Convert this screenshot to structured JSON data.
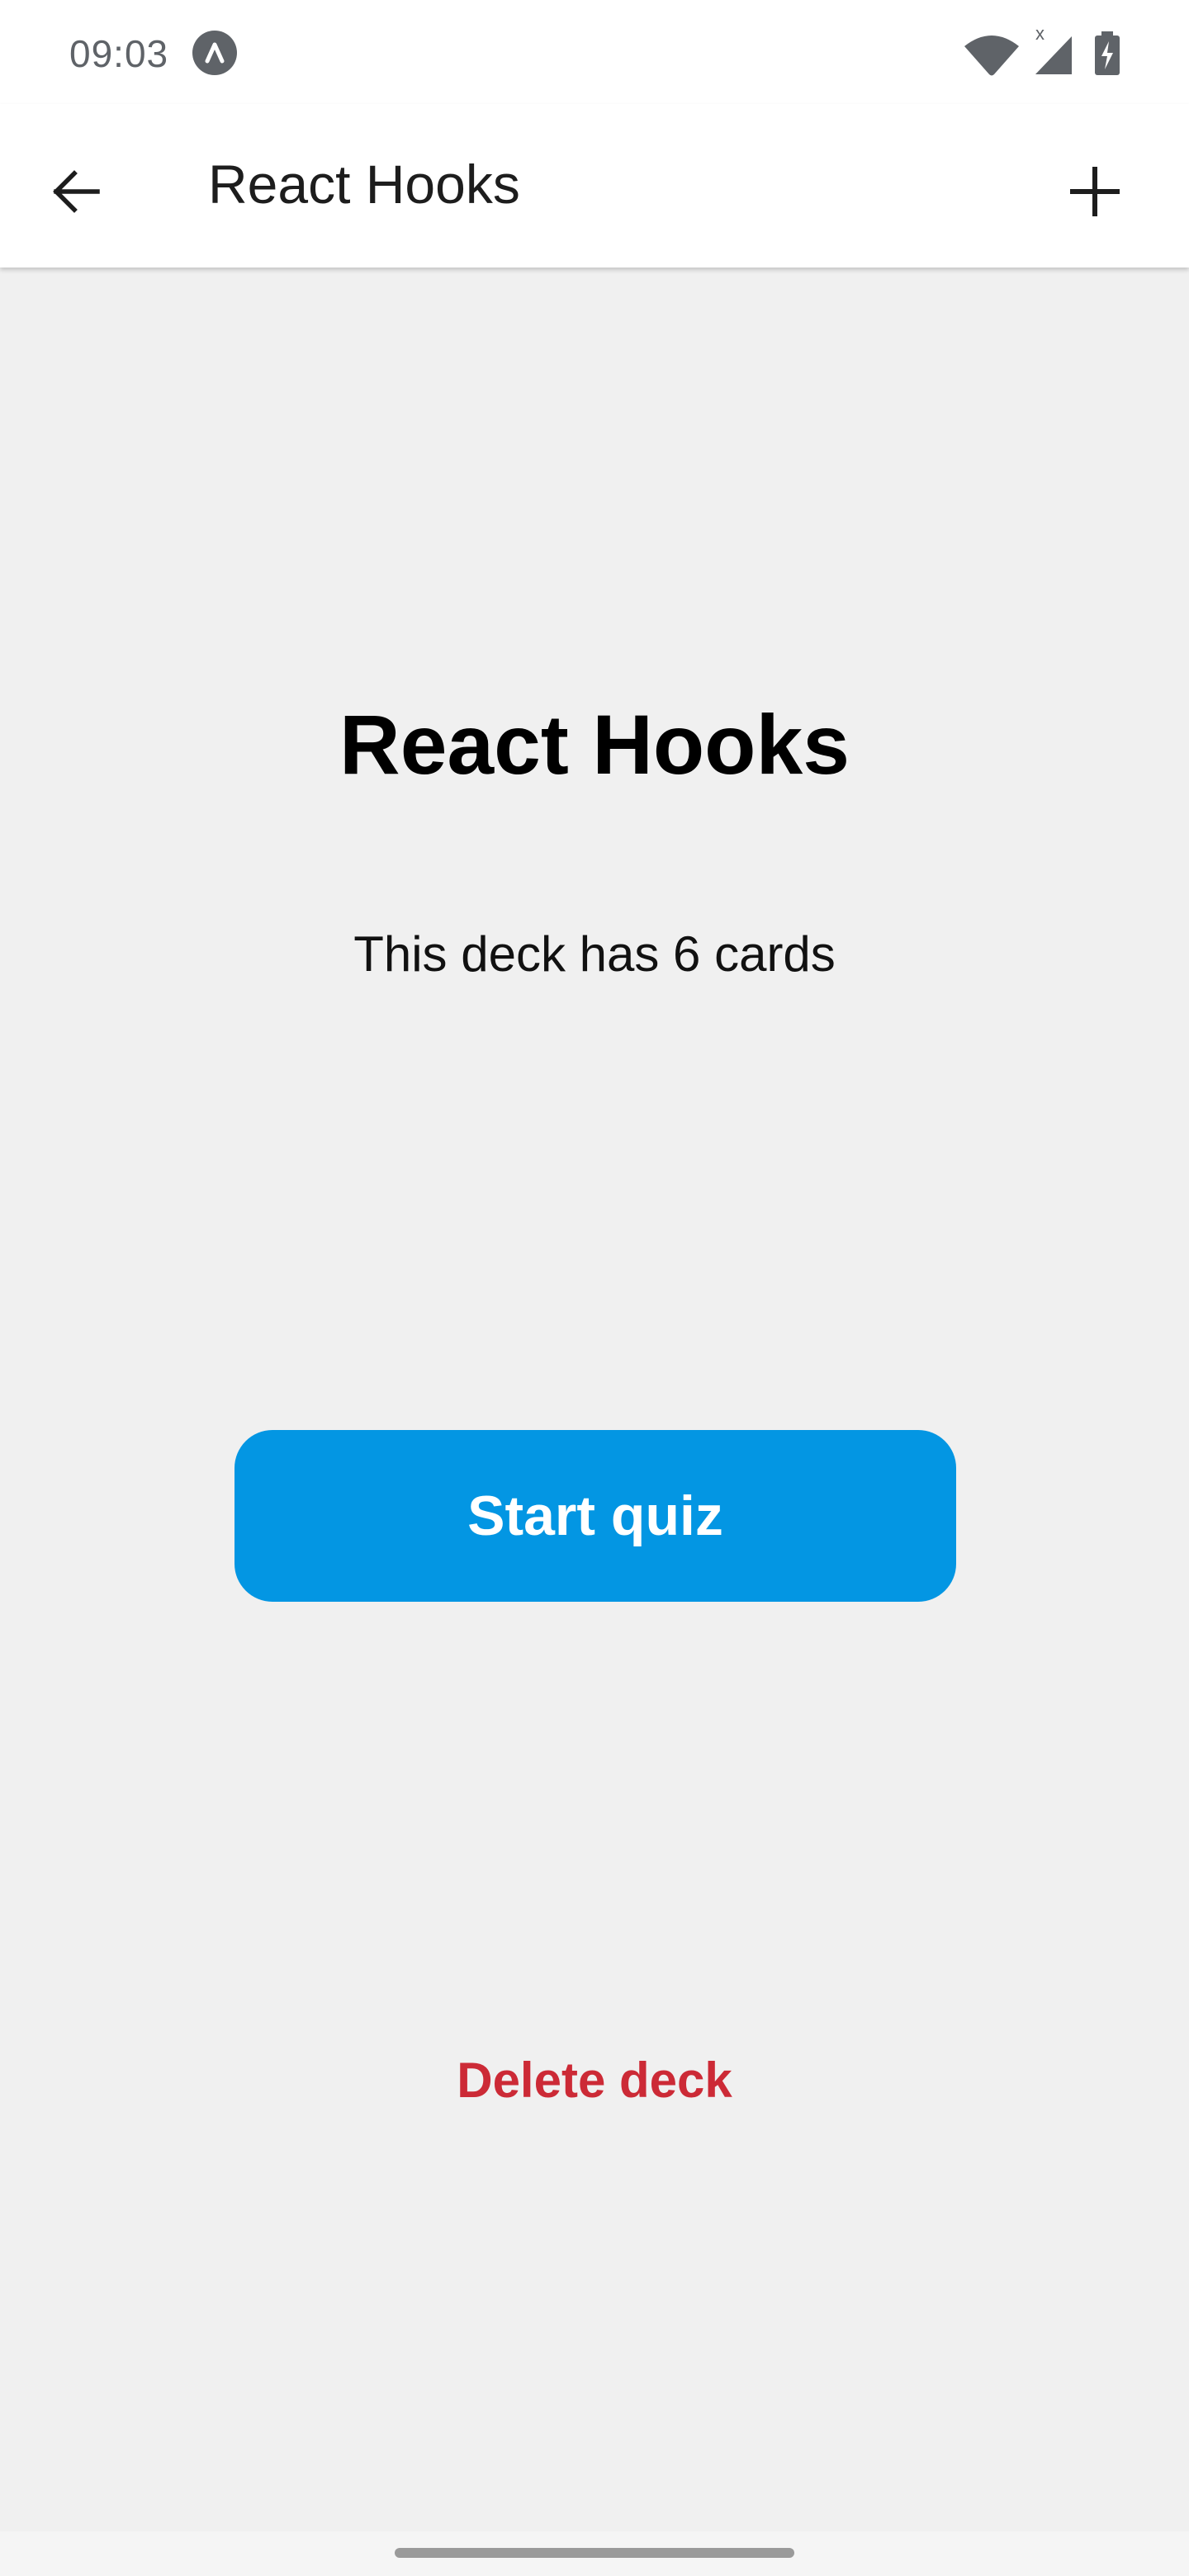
{
  "status_bar": {
    "time": "09:03",
    "signal_label": "x",
    "icons": [
      "app-notification-icon",
      "wifi-icon",
      "cell-signal-icon",
      "battery-charging-icon"
    ]
  },
  "app_bar": {
    "title": "React Hooks",
    "back_icon": "arrow-left-icon",
    "add_icon": "plus-icon"
  },
  "deck": {
    "title": "React Hooks",
    "card_count_text": "This deck has 6 cards"
  },
  "actions": {
    "start_quiz_label": "Start quiz",
    "delete_deck_label": "Delete deck"
  },
  "colors": {
    "primary": "#0396e3",
    "danger": "#cc2a36",
    "background": "#f0f0f0",
    "surface": "#ffffff"
  }
}
